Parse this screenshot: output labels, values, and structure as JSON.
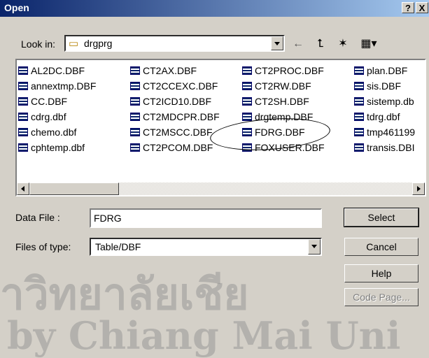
{
  "window": {
    "title": "Open",
    "help_glyph": "?",
    "close_glyph": "X"
  },
  "lookin": {
    "label": "Look in:",
    "value": "drgprg"
  },
  "toolbar": {
    "back": "←",
    "up": "⮤",
    "new_folder": "✶",
    "view": "▦▾"
  },
  "files": {
    "col1": [
      "AL2DC.DBF",
      "annextmp.DBF",
      "CC.DBF",
      "cdrg.dbf",
      "chemo.dbf",
      "cphtemp.dbf"
    ],
    "col2": [
      "CT2AX.DBF",
      "CT2CCEXC.DBF",
      "CT2ICD10.DBF",
      "CT2MDCPR.DBF",
      "CT2MSCC.DBF",
      "CT2PCOM.DBF"
    ],
    "col3": [
      "CT2PROC.DBF",
      "CT2RW.DBF",
      "CT2SH.DBF",
      "drgtemp.DBF",
      "FDRG.DBF",
      "FOXUSER.DBF"
    ],
    "col4": [
      "plan.DBF",
      "sis.DBF",
      "sistemp.db",
      "tdrg.dbf",
      "tmp461199",
      "transis.DBI"
    ]
  },
  "datafile": {
    "label": "Data File :",
    "value": "FDRG"
  },
  "filetype": {
    "label": "Files of type:",
    "value": "Table/DBF"
  },
  "buttons": {
    "select": "Select",
    "cancel": "Cancel",
    "help": "Help",
    "codepage": "Code Page..."
  },
  "watermark": {
    "line1": "าวิทยาลัยเชีย",
    "line2": "by Chiang Mai Uni"
  }
}
